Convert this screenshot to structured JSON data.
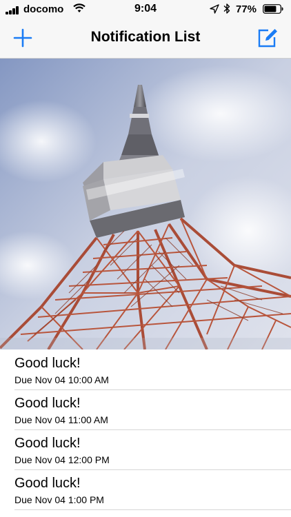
{
  "status_bar": {
    "carrier": "docomo",
    "time": "9:04",
    "battery": "77%",
    "battery_level": 0.77,
    "icons": [
      "signal-bars-icon",
      "wifi-icon",
      "location-icon",
      "bluetooth-icon",
      "battery-icon"
    ]
  },
  "nav": {
    "title": "Notification List",
    "left_icon": "plus-icon",
    "right_icon": "compose-icon",
    "accent_color": "#1a7cf5"
  },
  "photo": {
    "subject_icon": "tower-photo"
  },
  "notifications": [
    {
      "title": "Good luck!",
      "due": "Due Nov 04  10:00 AM"
    },
    {
      "title": "Good luck!",
      "due": "Due Nov 04  11:00 AM"
    },
    {
      "title": "Good luck!",
      "due": "Due Nov 04  12:00 PM"
    },
    {
      "title": "Good luck!",
      "due": "Due Nov 04  1:00 PM"
    }
  ]
}
